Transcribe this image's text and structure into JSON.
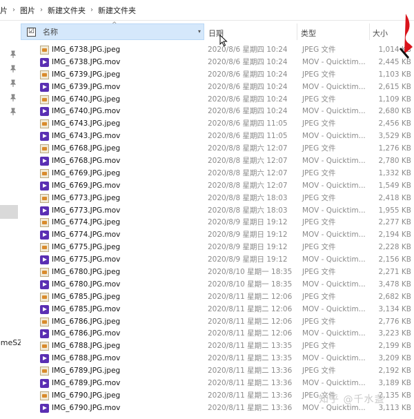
{
  "breadcrumb": {
    "items": [
      "片",
      "图片",
      "新建文件夹",
      "新建文件夹"
    ]
  },
  "nav": {
    "truncated_label": "omeSZ"
  },
  "header": {
    "name": "名称",
    "date": "日期",
    "type": "类型",
    "size": "大小",
    "check_glyph": "☑",
    "sort_glyph": "^"
  },
  "files": [
    {
      "name": "IMG_6738.JPG.jpeg",
      "kind": "jpeg",
      "date": "2020/8/6 星期四 10:24",
      "type": "JPEG 文件",
      "size": "1,014 KB"
    },
    {
      "name": "IMG_6738.JPG.mov",
      "kind": "mov",
      "date": "2020/8/6 星期四 10:24",
      "type": "MOV - Quicktim...",
      "size": "2,445 KB"
    },
    {
      "name": "IMG_6739.JPG.jpeg",
      "kind": "jpeg",
      "date": "2020/8/6 星期四 10:24",
      "type": "JPEG 文件",
      "size": "1,103 KB"
    },
    {
      "name": "IMG_6739.JPG.mov",
      "kind": "mov",
      "date": "2020/8/6 星期四 10:24",
      "type": "MOV - Quicktim...",
      "size": "2,615 KB"
    },
    {
      "name": "IMG_6740.JPG.jpeg",
      "kind": "jpeg",
      "date": "2020/8/6 星期四 10:24",
      "type": "JPEG 文件",
      "size": "1,109 KB"
    },
    {
      "name": "IMG_6740.JPG.mov",
      "kind": "mov",
      "date": "2020/8/6 星期四 10:24",
      "type": "MOV - Quicktim...",
      "size": "2,680 KB"
    },
    {
      "name": "IMG_6743.JPG.jpeg",
      "kind": "jpeg",
      "date": "2020/8/6 星期四 11:05",
      "type": "JPEG 文件",
      "size": "2,456 KB"
    },
    {
      "name": "IMG_6743.JPG.mov",
      "kind": "mov",
      "date": "2020/8/6 星期四 11:05",
      "type": "MOV - Quicktim...",
      "size": "3,529 KB"
    },
    {
      "name": "IMG_6768.JPG.jpeg",
      "kind": "jpeg",
      "date": "2020/8/8 星期六 12:07",
      "type": "JPEG 文件",
      "size": "1,276 KB"
    },
    {
      "name": "IMG_6768.JPG.mov",
      "kind": "mov",
      "date": "2020/8/8 星期六 12:07",
      "type": "MOV - Quicktim...",
      "size": "2,780 KB"
    },
    {
      "name": "IMG_6769.JPG.jpeg",
      "kind": "jpeg",
      "date": "2020/8/8 星期六 12:07",
      "type": "JPEG 文件",
      "size": "1,332 KB"
    },
    {
      "name": "IMG_6769.JPG.mov",
      "kind": "mov",
      "date": "2020/8/8 星期六 12:07",
      "type": "MOV - Quicktim...",
      "size": "1,549 KB"
    },
    {
      "name": "IMG_6773.JPG.jpeg",
      "kind": "jpeg",
      "date": "2020/8/8 星期六 18:03",
      "type": "JPEG 文件",
      "size": "2,418 KB"
    },
    {
      "name": "IMG_6773.JPG.mov",
      "kind": "mov",
      "date": "2020/8/8 星期六 18:03",
      "type": "MOV - Quicktim...",
      "size": "1,955 KB"
    },
    {
      "name": "IMG_6774.JPG.jpeg",
      "kind": "jpeg",
      "date": "2020/8/9 星期日 19:12",
      "type": "JPEG 文件",
      "size": "2,277 KB"
    },
    {
      "name": "IMG_6774.JPG.mov",
      "kind": "mov",
      "date": "2020/8/9 星期日 19:12",
      "type": "MOV - Quicktim...",
      "size": "2,194 KB"
    },
    {
      "name": "IMG_6775.JPG.jpeg",
      "kind": "jpeg",
      "date": "2020/8/9 星期日 19:12",
      "type": "JPEG 文件",
      "size": "2,228 KB"
    },
    {
      "name": "IMG_6775.JPG.mov",
      "kind": "mov",
      "date": "2020/8/9 星期日 19:12",
      "type": "MOV - Quicktim...",
      "size": "2,156 KB"
    },
    {
      "name": "IMG_6780.JPG.jpeg",
      "kind": "jpeg",
      "date": "2020/8/10 星期一 18:35",
      "type": "JPEG 文件",
      "size": "2,271 KB"
    },
    {
      "name": "IMG_6780.JPG.mov",
      "kind": "mov",
      "date": "2020/8/10 星期一 18:35",
      "type": "MOV - Quicktim...",
      "size": "3,478 KB"
    },
    {
      "name": "IMG_6785.JPG.jpeg",
      "kind": "jpeg",
      "date": "2020/8/11 星期二 12:06",
      "type": "JPEG 文件",
      "size": "2,682 KB"
    },
    {
      "name": "IMG_6785.JPG.mov",
      "kind": "mov",
      "date": "2020/8/11 星期二 12:06",
      "type": "MOV - Quicktim...",
      "size": "3,134 KB"
    },
    {
      "name": "IMG_6786.JPG.jpeg",
      "kind": "jpeg",
      "date": "2020/8/11 星期二 12:06",
      "type": "JPEG 文件",
      "size": "2,776 KB"
    },
    {
      "name": "IMG_6786.JPG.mov",
      "kind": "mov",
      "date": "2020/8/11 星期二 12:06",
      "type": "MOV - Quicktim...",
      "size": "3,223 KB"
    },
    {
      "name": "IMG_6788.JPG.jpeg",
      "kind": "jpeg",
      "date": "2020/8/11 星期二 13:35",
      "type": "JPEG 文件",
      "size": "2,199 KB"
    },
    {
      "name": "IMG_6788.JPG.mov",
      "kind": "mov",
      "date": "2020/8/11 星期二 13:35",
      "type": "MOV - Quicktim...",
      "size": "3,209 KB"
    },
    {
      "name": "IMG_6789.JPG.jpeg",
      "kind": "jpeg",
      "date": "2020/8/11 星期二 13:36",
      "type": "JPEG 文件",
      "size": "2,192 KB"
    },
    {
      "name": "IMG_6789.JPG.mov",
      "kind": "mov",
      "date": "2020/8/11 星期二 13:36",
      "type": "MOV - Quicktim...",
      "size": "3,189 KB"
    },
    {
      "name": "IMG_6790.JPG.jpeg",
      "kind": "jpeg",
      "date": "2020/8/11 星期二 13:36",
      "type": "JPEG 文件",
      "size": "2,135 KB"
    },
    {
      "name": "IMG_6790.JPG.mov",
      "kind": "mov",
      "date": "2020/8/11 星期二 13:36",
      "type": "MOV - Quicktim...",
      "size": "3,113 KB"
    }
  ],
  "watermark": "知乎 @千水盏",
  "colors": {
    "header_highlight": "#d5e8fb",
    "mov_icon": "#5a2fb3",
    "jpeg_icon_accent": "#d98b2c",
    "secondary_text": "#8a8a8a"
  }
}
